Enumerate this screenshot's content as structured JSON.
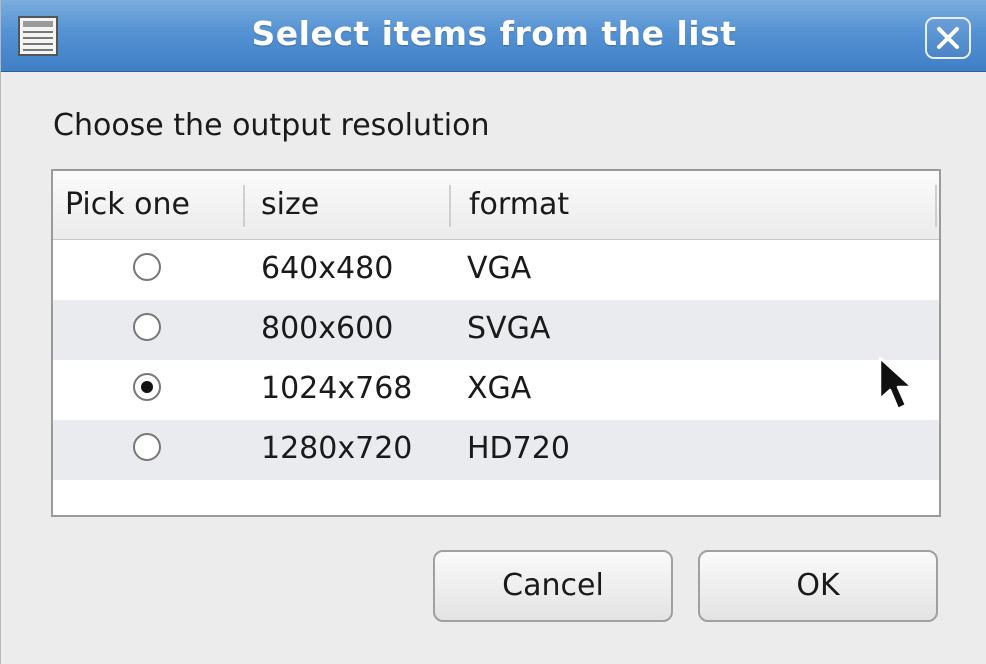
{
  "window": {
    "title": "Select items from the list",
    "icon": "list-icon",
    "close_icon": "close-icon"
  },
  "prompt": "Choose the output resolution",
  "list": {
    "columns": [
      "Pick one",
      "size",
      "format"
    ],
    "rows": [
      {
        "selected": false,
        "size": "640x480",
        "format": "VGA"
      },
      {
        "selected": false,
        "size": "800x600",
        "format": "SVGA"
      },
      {
        "selected": true,
        "size": "1024x768",
        "format": "XGA"
      },
      {
        "selected": false,
        "size": "1280x720",
        "format": "HD720"
      }
    ]
  },
  "buttons": {
    "cancel": "Cancel",
    "ok": "OK"
  },
  "colors": {
    "titlebar": "#4a89cc",
    "background": "#ececec",
    "alt_row": "#e9ebef"
  }
}
